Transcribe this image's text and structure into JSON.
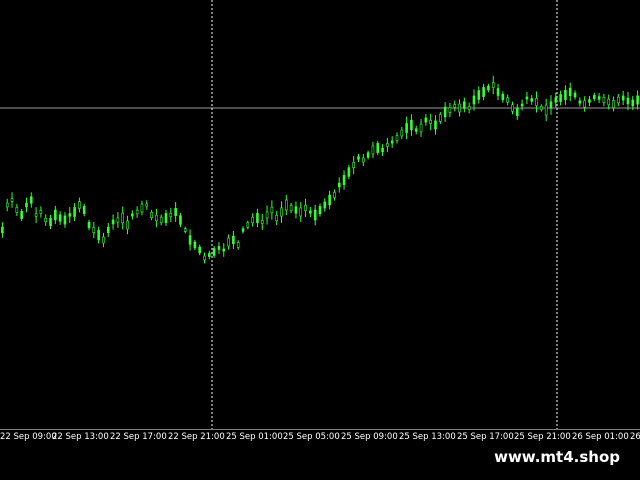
{
  "chart_data": {
    "type": "candlestick",
    "candle_color": "#33ff33",
    "background_color": "#000000",
    "grid_color": "#c0c0c0",
    "period_separator": "dotted",
    "x_tick_labels": [
      "22 Sep 09:00",
      "22 Sep 13:00",
      "22 Sep 17:00",
      "22 Sep 21:00",
      "25 Sep 01:00",
      "25 Sep 05:00",
      "25 Sep 09:00",
      "25 Sep 13:00",
      "25 Sep 17:00",
      "25 Sep 21:00",
      "26 Sep 01:00",
      "26"
    ],
    "day_separators": [
      "25 Sep 01:00",
      "26 Sep 01:00"
    ],
    "series": [
      {
        "values": [
          230,
          205,
          200,
          210,
          215,
          205,
          200,
          215,
          212,
          220,
          222,
          215,
          218,
          220,
          215,
          212,
          205,
          210,
          225,
          230,
          235,
          240,
          230,
          222,
          220,
          218,
          225,
          215,
          212,
          208,
          205,
          215,
          218,
          220,
          218,
          215,
          212,
          220,
          230,
          240,
          245,
          250,
          258,
          255,
          252,
          248,
          250,
          242,
          240,
          245,
          230,
          225,
          220,
          218,
          222,
          215,
          210,
          218,
          212,
          205,
          208,
          210,
          212,
          208,
          212,
          215,
          210,
          205,
          200,
          195,
          185,
          180,
          172,
          165,
          158,
          160,
          155,
          150,
          148,
          150,
          145,
          142,
          138,
          133,
          128,
          125,
          130,
          128,
          120,
          122,
          125,
          118,
          112,
          110,
          106,
          108,
          105,
          108,
          100,
          95,
          92,
          88,
          85,
          92,
          97,
          100,
          108,
          112,
          105,
          98,
          100,
          102,
          108,
          110,
          105,
          100,
          98,
          95,
          92,
          95,
          102,
          104,
          101,
          97,
          98,
          100,
          102,
          104,
          100,
          98,
          101,
          103,
          100
        ]
      }
    ]
  },
  "horizontal_line_price": 108,
  "watermark": "www.mt4.shop"
}
